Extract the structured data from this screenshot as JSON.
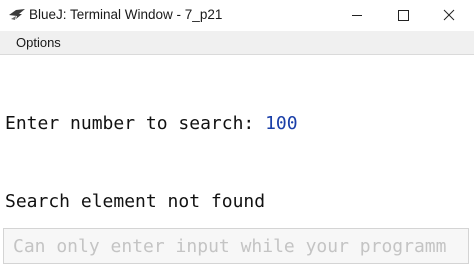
{
  "window": {
    "title": "BlueJ: Terminal Window - 7_p21",
    "icon": "bluej-bird-icon",
    "controls": [
      "minimize-icon",
      "maximize-icon",
      "close-icon"
    ]
  },
  "menu": {
    "options_label": "Options"
  },
  "terminal": {
    "lines": [
      {
        "prompt": "Enter number to search: ",
        "input": "100"
      },
      {
        "text": "Search element not found"
      }
    ]
  },
  "input_bar": {
    "placeholder": "Can only enter input while your programm"
  },
  "colors": {
    "user_input": "#1a3fa8",
    "placeholder_text": "#c4c4c4",
    "menubar_bg": "#f0f0f0"
  }
}
